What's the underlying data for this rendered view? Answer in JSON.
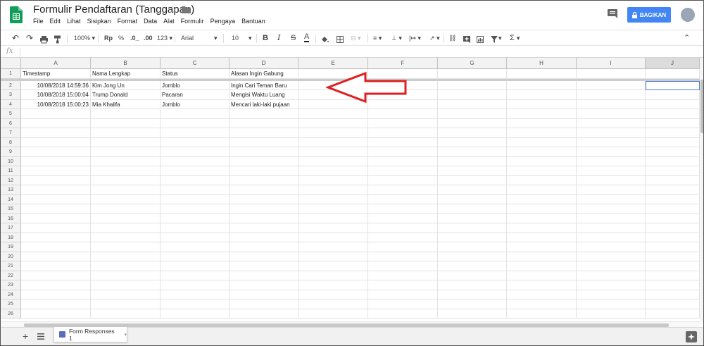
{
  "doc": {
    "title": "Formulir Pendaftaran (Tanggapan)",
    "menu": [
      "File",
      "Edit",
      "Lihat",
      "Sisipkan",
      "Format",
      "Data",
      "Alat",
      "Formulir",
      "Pengaya",
      "Bantuan"
    ],
    "share_label": "BAGIKAN"
  },
  "toolbar": {
    "zoom": "100%",
    "currency": "Rp",
    "percent": "%",
    "decimal_decrease": ".0_",
    "decimal_increase": ".00",
    "more_formats": "123",
    "font": "Arial",
    "font_size": "10",
    "bold": "B",
    "italic": "I",
    "strike": "S",
    "text_color": "A",
    "sum": "Σ"
  },
  "formula_bar": {
    "fx": "fx",
    "value": ""
  },
  "columns": [
    "A",
    "B",
    "C",
    "D",
    "E",
    "F",
    "G",
    "H",
    "I",
    "J"
  ],
  "rows": [
    {
      "num": "1",
      "cells": [
        "Timestamp",
        "Nama Lengkap",
        "Status",
        "Alasan Ingin Gabung"
      ]
    },
    {
      "num": "2",
      "cells": [
        "10/08/2018 14:59:36",
        "Kim Jong Un",
        "Jomblo",
        "Ingin Cari Teman Baru"
      ]
    },
    {
      "num": "3",
      "cells": [
        "10/08/2018 15:00:04",
        "Trump Donald",
        "Pacaran",
        "Mengisi Waktu Luang"
      ]
    },
    {
      "num": "4",
      "cells": [
        "10/08/2018 15:00:23",
        "Mia Khalifa",
        "Jomblo",
        "Mencari laki-laki pujaan"
      ]
    },
    {
      "num": "5",
      "cells": []
    },
    {
      "num": "6",
      "cells": []
    },
    {
      "num": "7",
      "cells": []
    },
    {
      "num": "8",
      "cells": []
    },
    {
      "num": "9",
      "cells": []
    },
    {
      "num": "10",
      "cells": []
    },
    {
      "num": "11",
      "cells": []
    },
    {
      "num": "12",
      "cells": []
    },
    {
      "num": "13",
      "cells": []
    },
    {
      "num": "14",
      "cells": []
    },
    {
      "num": "15",
      "cells": []
    },
    {
      "num": "16",
      "cells": []
    },
    {
      "num": "17",
      "cells": []
    },
    {
      "num": "18",
      "cells": []
    },
    {
      "num": "19",
      "cells": []
    },
    {
      "num": "20",
      "cells": []
    },
    {
      "num": "21",
      "cells": []
    },
    {
      "num": "22",
      "cells": []
    },
    {
      "num": "23",
      "cells": []
    },
    {
      "num": "24",
      "cells": []
    },
    {
      "num": "25",
      "cells": []
    },
    {
      "num": "26",
      "cells": []
    }
  ],
  "sheet_tabs": [
    {
      "label": "Form Responses 1"
    }
  ],
  "colors": {
    "share": "#4285f4",
    "arrow": "#e02020",
    "selection": "#4a7bd1",
    "sheets_green": "#0f9d58"
  }
}
